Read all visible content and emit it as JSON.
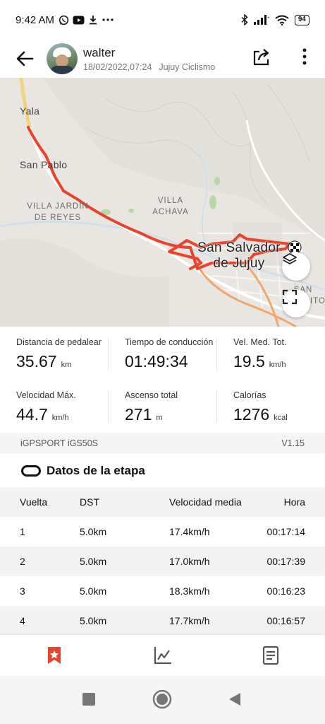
{
  "status_bar": {
    "time": "9:42 AM",
    "battery": "94",
    "left_icons": [
      "whatsapp-icon",
      "youtube-icon",
      "download-icon",
      "more-dots-icon"
    ],
    "right_icons": [
      "bluetooth-icon",
      "signal-icon",
      "wifi-icon",
      "battery-icon"
    ]
  },
  "header": {
    "user_name": "walter",
    "datetime": "18/02/2022,07:24",
    "activity_name": "Jujuy Ciclismo"
  },
  "map": {
    "labels": {
      "yala": "Yala",
      "san_pablo": "San Pablo",
      "villa_jardin_1": "VILLA JARDÍN",
      "villa_jardin_2": "DE REYES",
      "villa_achava_1": "VILLA",
      "villa_achava_2": "ACHAVA",
      "san_salvador_1": "San Salvador",
      "san_salvador_2": "de Jujuy",
      "san_pedrito_1": "SAN",
      "san_pedrito_2": "PEDRITO"
    },
    "route_color": "#e8432c"
  },
  "stats": [
    {
      "label": "Distancia de pedalear",
      "value": "35.67",
      "unit": "km"
    },
    {
      "label": "Tiempo de conducción",
      "value": "01:49:34",
      "unit": ""
    },
    {
      "label": "Vel. Med. Tot.",
      "value": "19.5",
      "unit": "km/h"
    },
    {
      "label": "Velocidad Máx.",
      "value": "44.7",
      "unit": "km/h"
    },
    {
      "label": "Ascenso total",
      "value": "271",
      "unit": "m"
    },
    {
      "label": "Calorías",
      "value": "1276",
      "unit": "kcal"
    }
  ],
  "device": {
    "name": "iGPSPORT iGS50S",
    "version": "V1.15"
  },
  "laps_section": {
    "title": "Datos de la etapa",
    "columns": [
      "Vuelta",
      "DST",
      "Velocidad media",
      "Hora"
    ],
    "rows": [
      [
        "1",
        "5.0km",
        "17.4km/h",
        "00:17:14"
      ],
      [
        "2",
        "5.0km",
        "17.0km/h",
        "00:17:39"
      ],
      [
        "3",
        "5.0km",
        "18.3km/h",
        "00:16:23"
      ],
      [
        "4",
        "5.0km",
        "17.7km/h",
        "00:16:57"
      ]
    ]
  },
  "tabbar": {
    "tabs": [
      "summary-tab-icon",
      "chart-tab-icon",
      "details-tab-icon"
    ],
    "active_color": "#e8432c"
  },
  "navbar": {
    "buttons": [
      "recents-button",
      "home-button",
      "back-nav-button"
    ]
  }
}
